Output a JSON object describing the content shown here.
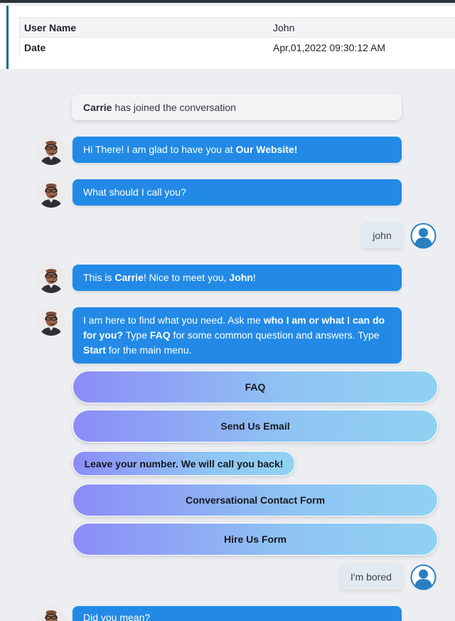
{
  "info": {
    "rows": [
      {
        "label": "User Name",
        "value": "John"
      },
      {
        "label": "Date",
        "value": "Apr,01,2022 09:30:12 AM"
      }
    ]
  },
  "system_message": {
    "name": "Carrie",
    "text": "has joined the conversation"
  },
  "messages": {
    "m1": {
      "pre": "Hi There! I am glad to have you at ",
      "bold": "Our Website!"
    },
    "m2": {
      "text": "What should I call you?"
    },
    "user1": "john",
    "m3": {
      "pre": "This is ",
      "bold1": "Carrie",
      "mid": "! Nice to meet you, ",
      "bold2": "John",
      "post": "!"
    },
    "m4": {
      "pre": "I am here to find what you need. Ask me ",
      "bold1": "who I am or what I can do for you?",
      "mid1": " Type ",
      "bold2": "FAQ",
      "mid2": " for some common question and answers. Type ",
      "bold3": "Start",
      "post": " for the main menu."
    },
    "user2": "I'm bored",
    "m5": {
      "text": "Did you mean?"
    }
  },
  "options": [
    {
      "label": "FAQ"
    },
    {
      "label": "Send Us Email"
    },
    {
      "label": "Leave your number. We will call you back!"
    },
    {
      "label": "Conversational Contact Form"
    },
    {
      "label": "Hire Us Form"
    }
  ],
  "icons": {
    "agent": "agent-avatar-icon",
    "user": "user-avatar-icon"
  },
  "colors": {
    "bot_bubble": "#228ae6",
    "user_bubble": "#e3e9f0",
    "accent": "#0f6b8e",
    "user_icon": "#2a7fc1"
  }
}
